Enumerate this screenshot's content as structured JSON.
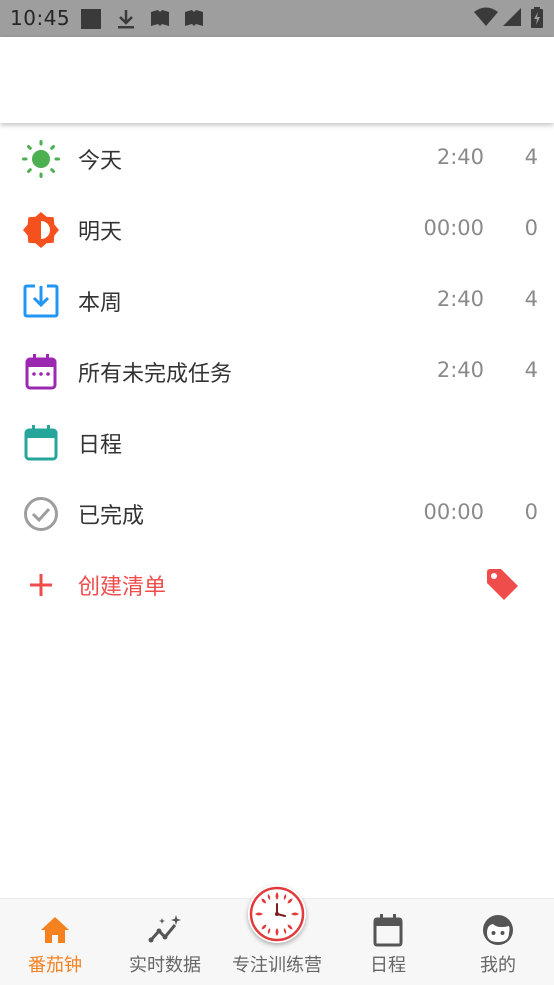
{
  "status_bar": {
    "time": "10:45"
  },
  "list": {
    "items": [
      {
        "label": "今天",
        "time": "2:40",
        "count": "4",
        "icon": "sun-icon",
        "color": "#4caf50"
      },
      {
        "label": "明天",
        "time": "00:00",
        "count": "0",
        "icon": "half-sun-icon",
        "color": "#f5511e"
      },
      {
        "label": "本周",
        "time": "2:40",
        "count": "4",
        "icon": "download-box-icon",
        "color": "#2196f3"
      },
      {
        "label": "所有未完成任务",
        "time": "2:40",
        "count": "4",
        "icon": "calendar-dots-icon",
        "color": "#9c27b0"
      },
      {
        "label": "日程",
        "time": "",
        "count": "",
        "icon": "calendar-icon",
        "color": "#26a69a"
      },
      {
        "label": "已完成",
        "time": "00:00",
        "count": "0",
        "icon": "check-circle-icon",
        "color": "#9e9e9e"
      }
    ],
    "create": {
      "label": "创建清单",
      "icon": "plus-icon",
      "tag_icon": "tag-icon",
      "color": "#ef4c4c"
    }
  },
  "bottom_nav": {
    "items": [
      {
        "label": "番茄钟",
        "icon": "home-icon",
        "active": true
      },
      {
        "label": "实时数据",
        "icon": "trend-icon",
        "active": false
      },
      {
        "label": "专注训练营",
        "icon": "clock-icon",
        "active": false
      },
      {
        "label": "日程",
        "icon": "calendar-icon",
        "active": false
      },
      {
        "label": "我的",
        "icon": "face-icon",
        "active": false
      }
    ],
    "active_color": "#f5811f"
  }
}
